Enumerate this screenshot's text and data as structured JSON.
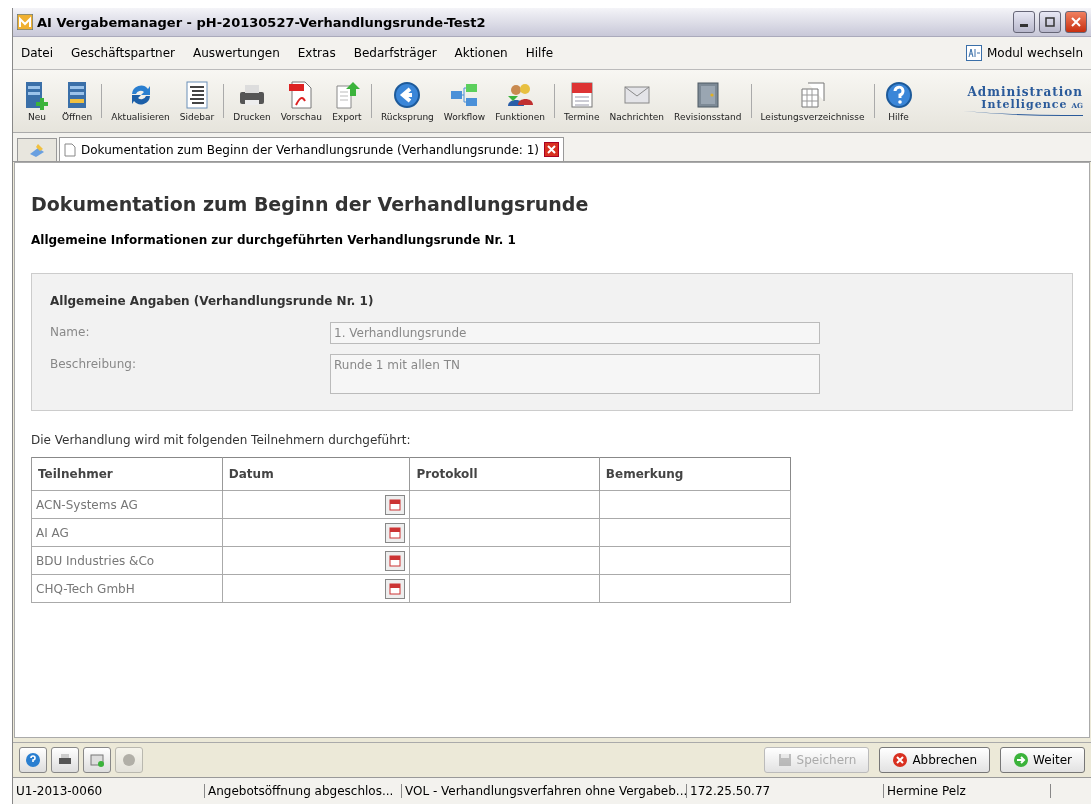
{
  "window": {
    "title": "AI Vergabemanager - pH-20130527-Verhandlungsrunde-Test2"
  },
  "menu": [
    "Datei",
    "Geschäftspartner",
    "Auswertungen",
    "Extras",
    "Bedarfsträger",
    "Aktionen",
    "Hilfe"
  ],
  "module_switch": {
    "label": "Modul wechseln"
  },
  "toolbar": [
    [
      "Neu",
      "Öffnen"
    ],
    [
      "Aktualisieren",
      "Sidebar"
    ],
    [
      "Drucken",
      "Vorschau",
      "Export"
    ],
    [
      "Rücksprung",
      "Workflow",
      "Funktionen"
    ],
    [
      "Termine",
      "Nachrichten",
      "Revisionsstand"
    ],
    [
      "Leistungsverzeichnisse"
    ],
    [
      "Hilfe"
    ]
  ],
  "logo": {
    "line_1": "Administration",
    "line_2": "Intelligence",
    "suffix": "AG"
  },
  "tabs": [
    {
      "label": "Dokumentation zum Beginn der Verhandlungsrunde (Verhandlungsrunde: 1)",
      "selected": true
    }
  ],
  "page": {
    "title": "Dokumentation zum Beginn der Verhandlungsrunde",
    "subtitle": "Allgemeine Informationen zur durchgeführten Verhandlungsrunde Nr. 1"
  },
  "general": {
    "heading": "Allgemeine Angaben (Verhandlungsrunde Nr. 1)",
    "fields": [
      {
        "label": "Name:",
        "value": "1. Verhandlungsrunde",
        "kind": "line",
        "disabled": true
      },
      {
        "label": "Beschreibung:",
        "value": "Runde 1 mit allen TN",
        "kind": "area",
        "disabled": true
      }
    ]
  },
  "participants_intro": "Die Verhandlung wird mit folgenden Teilnehmern durchgeführt:",
  "table": {
    "columns": [
      "Teilnehmer",
      "Datum",
      "Protokoll",
      "Bemerkung"
    ],
    "rows": [
      {
        "teilnehmer": "ACN-Systems AG"
      },
      {
        "teilnehmer": "AI AG"
      },
      {
        "teilnehmer": "BDU Industries &Co"
      },
      {
        "teilnehmer": "CHQ-Tech GmbH"
      }
    ]
  },
  "bottom_icons": [
    {
      "disabled": false
    },
    {
      "disabled": false
    },
    {
      "disabled": false
    },
    {
      "disabled": true
    }
  ],
  "buttons": [
    {
      "label": "Speichern",
      "disabled": true
    },
    {
      "label": "Abbrechen",
      "disabled": false
    },
    {
      "label": "Weiter",
      "disabled": false
    }
  ],
  "status_bar": [
    "U1-2013-0060",
    "Angebotsöffnung abgeschlos...",
    "VOL - Verhandlungsverfahren ohne Vergabeb...",
    "172.25.50.77",
    "Hermine Pelz"
  ]
}
